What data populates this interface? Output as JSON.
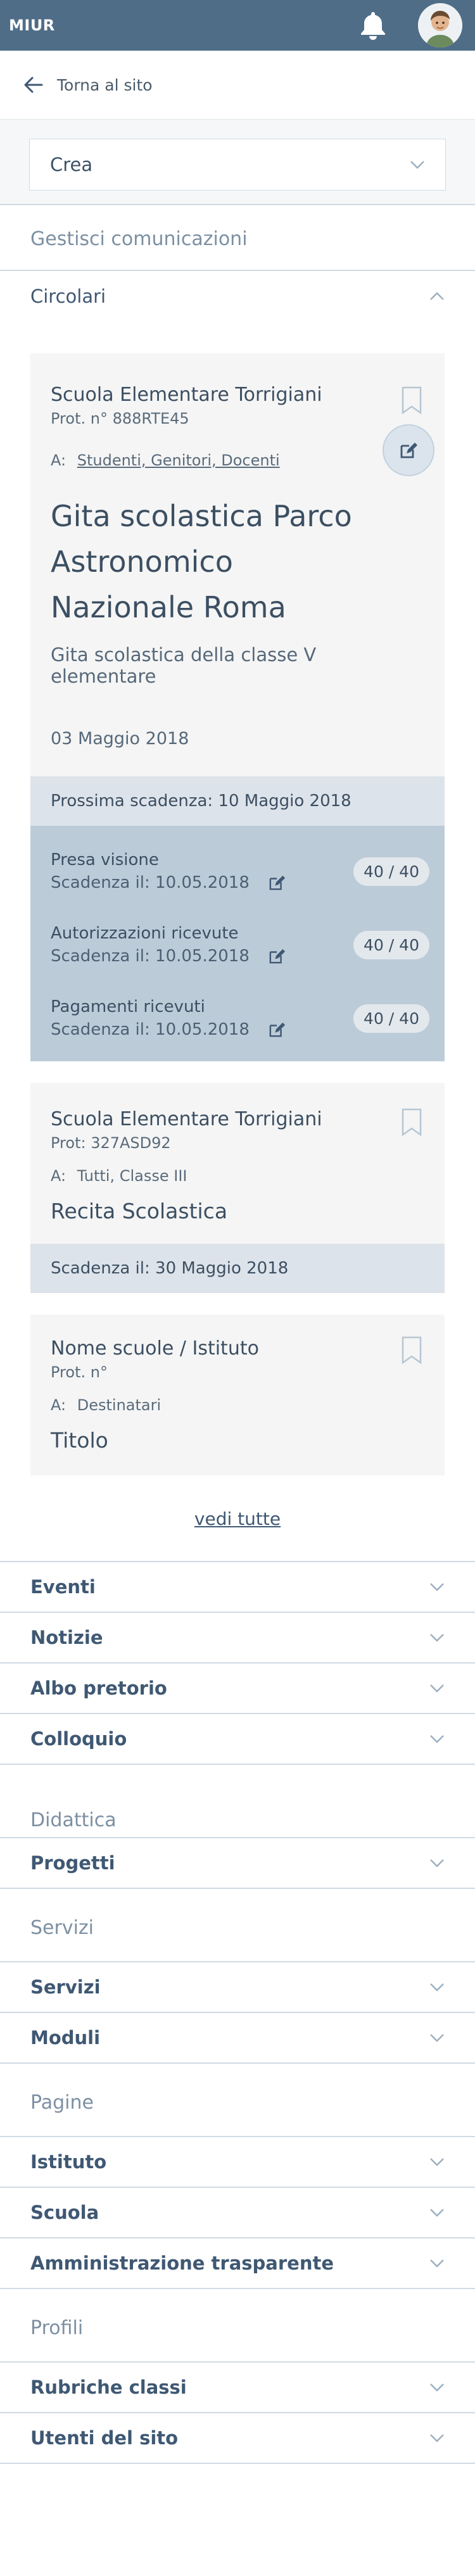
{
  "header": {
    "brand": "MIUR",
    "bell_icon": "bell-icon",
    "avatar_icon": "user-avatar"
  },
  "back": {
    "label": "Torna al sito"
  },
  "crea": {
    "label": "Crea"
  },
  "sections": {
    "gestisci": "Gestisci comunicazioni",
    "didattica": "Didattica",
    "servizi": "Servizi",
    "pagine": "Pagine",
    "profili": "Profili"
  },
  "circolari": {
    "label": "Circolari",
    "card1": {
      "school": "Scuola Elementare Torrigiani",
      "prot": "Prot. n° 888RTE45",
      "to_label": "A:",
      "recipients": "Studenti, Genitori, Docenti",
      "title": "Gita scolastica Parco Astronomico Nazionale Roma",
      "description": "Gita scolastica della classe V elementare",
      "date": "03 Maggio 2018",
      "next_deadline": "Prossima scadenza: 10 Maggio 2018",
      "tasks": [
        {
          "name": "Presa visione",
          "deadline": "Scadenza il: 10.05.2018",
          "count": "40 / 40"
        },
        {
          "name": "Autorizzazioni ricevute",
          "deadline": "Scadenza il: 10.05.2018",
          "count": "40 / 40"
        },
        {
          "name": "Pagamenti ricevuti",
          "deadline": "Scadenza il: 10.05.2018",
          "count": "40 / 40"
        }
      ]
    },
    "card2": {
      "school": "Scuola Elementare Torrigiani",
      "prot": "Prot: 327ASD92",
      "to_label": "A:",
      "recipients": "Tutti, Classe III",
      "title": "Recita Scolastica",
      "deadline": "Scadenza il: 30 Maggio 2018"
    },
    "card3": {
      "school": "Nome scuole / Istituto",
      "prot": "Prot. n°",
      "to_label": "A:",
      "recipients": "Destinatari",
      "title": "Titolo"
    },
    "see_all": "vedi tutte"
  },
  "accordions": {
    "eventi": "Eventi",
    "notizie": "Notizie",
    "albo": "Albo pretorio",
    "colloquio": "Colloquio",
    "progetti": "Progetti",
    "servizi": "Servizi",
    "moduli": "Moduli",
    "istituto": "Istituto",
    "scuola": "Scuola",
    "amministrazione": "Amministrazione trasparente",
    "rubriche": "Rubriche classi",
    "utenti": "Utenti del sito"
  },
  "colors": {
    "topbar": "#4f6d87",
    "accent": "#3f5873",
    "task_bg": "#bccbd8",
    "card_bg": "#f5f5f5"
  }
}
